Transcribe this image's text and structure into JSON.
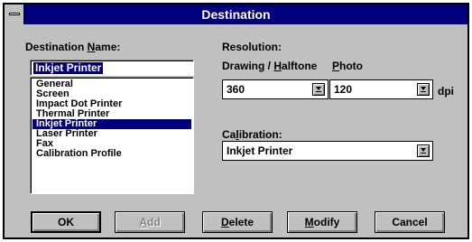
{
  "window": {
    "title": "Destination"
  },
  "destination_name": {
    "label_pre": "Destination ",
    "label_ul": "N",
    "label_post": "ame:",
    "value": "Inkjet Printer",
    "items": [
      {
        "label": "General",
        "selected": false
      },
      {
        "label": "Screen",
        "selected": false
      },
      {
        "label": "Impact Dot Printer",
        "selected": false
      },
      {
        "label": "Thermal Printer",
        "selected": false
      },
      {
        "label": "Inkjet Printer",
        "selected": true
      },
      {
        "label": "Laser Printer",
        "selected": false
      },
      {
        "label": "Fax",
        "selected": false
      },
      {
        "label": "Calibration Profile",
        "selected": false
      }
    ]
  },
  "resolution": {
    "label": "Resolution:",
    "drawing_pre": "Drawing / ",
    "drawing_ul": "H",
    "drawing_post": "alftone",
    "photo_ul": "P",
    "photo_post": "hoto",
    "drawing_value": "360",
    "photo_value": "120",
    "unit": "dpi"
  },
  "calibration": {
    "label_pre": "Ca",
    "label_ul": "l",
    "label_post": "ibration:",
    "value": "Inkjet Printer"
  },
  "buttons": {
    "ok": "OK",
    "add_pre": "",
    "add_ul": "A",
    "add_post": "dd",
    "delete_ul": "D",
    "delete_post": "elete",
    "modify_ul": "M",
    "modify_post": "odify",
    "cancel": "Cancel"
  }
}
